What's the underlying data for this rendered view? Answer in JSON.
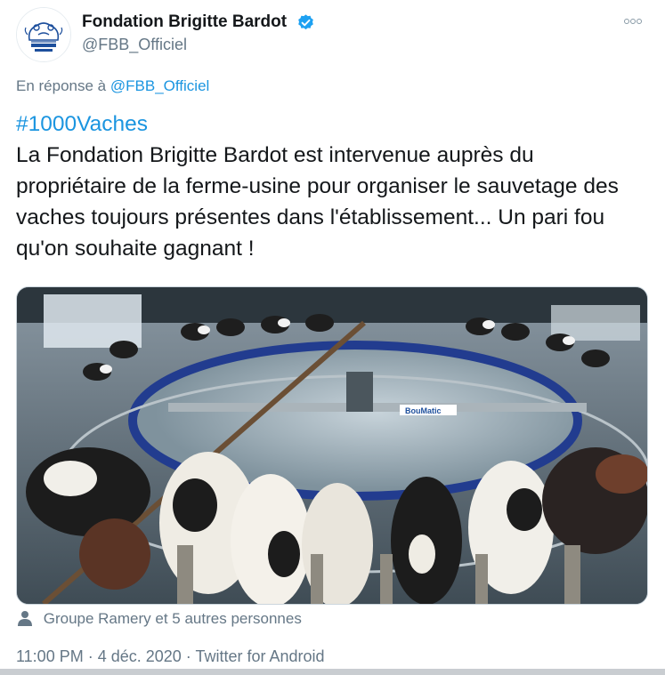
{
  "author": {
    "display_name": "Fondation Brigitte Bardot",
    "handle": "@FBB_Officiel",
    "verified": true,
    "avatar_logo_text": "FONDATION BRIGITTE BARDOT OFFICIEL"
  },
  "reply": {
    "prefix": "En réponse à",
    "mention": "@FBB_Officiel"
  },
  "tweet": {
    "hashtag": "#1000Vaches",
    "body": "La Fondation Brigitte Bardot est intervenue auprès du propriétaire de la ferme-usine pour organiser le sauvetage des vaches toujours présentes dans l'établissement... Un pari fou qu'on souhaite gagnant !",
    "media_sign_text": "BouMatic"
  },
  "tagged": {
    "label": "Groupe Ramery et 5 autres personnes"
  },
  "meta": {
    "line": "11:00 PM · 4 déc. 2020 · Twitter for Android"
  },
  "icons": {
    "verified": "verified-badge-icon",
    "more": "more-options-icon",
    "person": "person-icon"
  },
  "colors": {
    "link": "#1b95e0",
    "secondary_text": "#657786",
    "primary_text": "#14171a"
  }
}
